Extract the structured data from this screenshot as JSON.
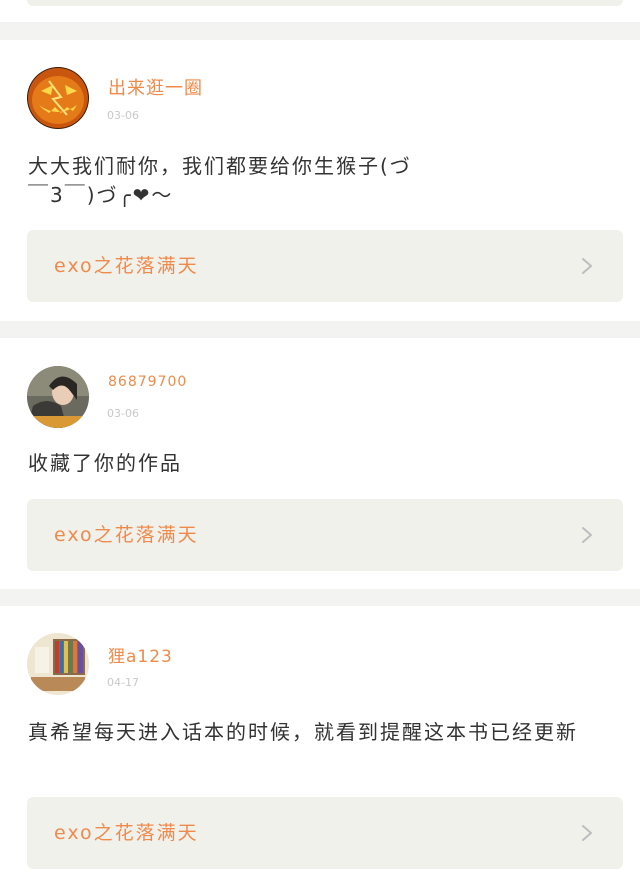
{
  "comments": [
    {
      "username": "出来逛一圈",
      "date": "03-06",
      "text": "大大我们耐你，我们都要给你生猴子(づ￣3￣)づ╭❤～",
      "work_title": "exo之花落满天",
      "avatar_icon": "pumpkin-avatar"
    },
    {
      "username": "86879700",
      "date": "03-06",
      "text": "收藏了你的作品",
      "work_title": "exo之花落满天",
      "avatar_icon": "girl-photo-avatar"
    },
    {
      "username": "狸a123",
      "date": "04-17",
      "text": "真希望每天进入话本的时候，就看到提醒这本书已经更新",
      "work_title": "exo之花落满天",
      "avatar_icon": "bookshelf-avatar"
    }
  ],
  "colors": {
    "accent": "#f08a4b",
    "date": "#c9c9c9",
    "text": "#333333",
    "work_box": "#f1f1ec",
    "background": "#f3f3f2"
  }
}
